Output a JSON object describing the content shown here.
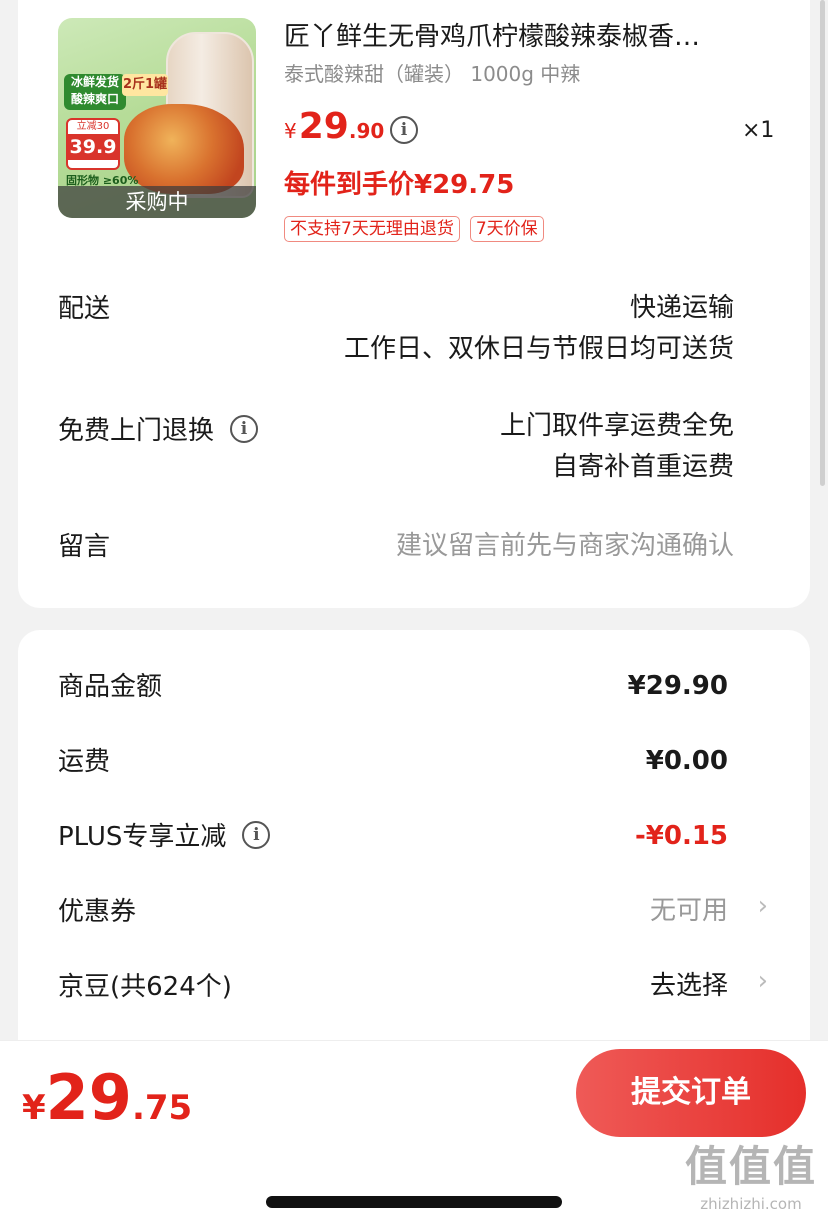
{
  "product": {
    "image_status": "采购中",
    "image_tag_1": "冰鲜发货 酸辣爽口",
    "image_tag_2": "2斤1罐",
    "image_tag_price_label": "立减30",
    "image_tag_price": "39.9",
    "image_tag_pct": "固形物 ≥60%",
    "title": "匠丫鲜生无骨鸡爪柠檬酸辣泰椒香…",
    "spec": "泰式酸辣甜（罐装） 1000g 中辣",
    "price_symbol": "¥",
    "price_int": "29",
    "price_dec": ".90",
    "quantity": "×1",
    "hand_price": "每件到手价¥29.75",
    "badges": [
      "不支持7天无理由退货",
      "7天价保"
    ]
  },
  "delivery": {
    "label": "配送",
    "line1": "快递运输",
    "line2": "工作日、双休日与节假日均可送货"
  },
  "return": {
    "label": "免费上门退换",
    "line1": "上门取件享运费全免",
    "line2": "自寄补首重运费"
  },
  "message": {
    "label": "留言",
    "placeholder": "建议留言前先与商家沟通确认"
  },
  "summary": {
    "goods_label": "商品金额",
    "goods_value": "¥29.90",
    "shipping_label": "运费",
    "shipping_value": "¥0.00",
    "plus_label": "PLUS专享立减",
    "plus_value": "-¥0.15",
    "coupon_label": "优惠券",
    "coupon_value": "无可用",
    "beans_label": "京豆(共624个)",
    "beans_value": "去选择"
  },
  "footer": {
    "total_symbol": "¥",
    "total_int": "29",
    "total_dec": ".75",
    "submit_label": "提交订单"
  },
  "watermark": {
    "logo": "值值值",
    "site": "zhizhizhi.com"
  },
  "colors": {
    "accent": "#e2231a",
    "background": "#f2f2f2"
  }
}
